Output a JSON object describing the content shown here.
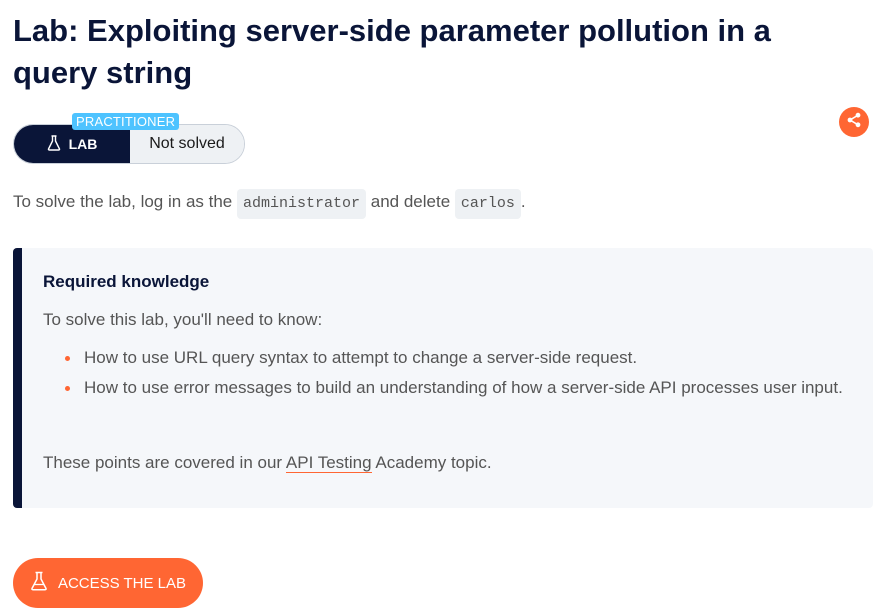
{
  "title": "Lab: Exploiting server-side parameter pollution in a query string",
  "level": {
    "badge": "PRACTITIONER",
    "lab_label": "LAB",
    "status": "Not solved"
  },
  "intro": {
    "prefix": "To solve the lab, log in as the",
    "user": "administrator",
    "middle": "and delete",
    "target": "carlos",
    "suffix": "."
  },
  "knowledge": {
    "heading": "Required knowledge",
    "intro": "To solve this lab, you'll need to know:",
    "bullets": [
      "How to use URL query syntax to attempt to change a server-side request.",
      "How to use error messages to build an understanding of how a server-side API processes user input."
    ],
    "footer_prefix": "These points are covered in our",
    "footer_link": "API Testing",
    "footer_suffix": "Academy topic."
  },
  "access_button": "ACCESS THE LAB",
  "icons": {
    "lab": "flask-icon",
    "share": "share-icon",
    "access": "flask-icon"
  },
  "colors": {
    "navy": "#0a1538",
    "accent": "#ff6633",
    "badge": "#4ec3ff",
    "panel_bg": "#f5f7fa"
  }
}
